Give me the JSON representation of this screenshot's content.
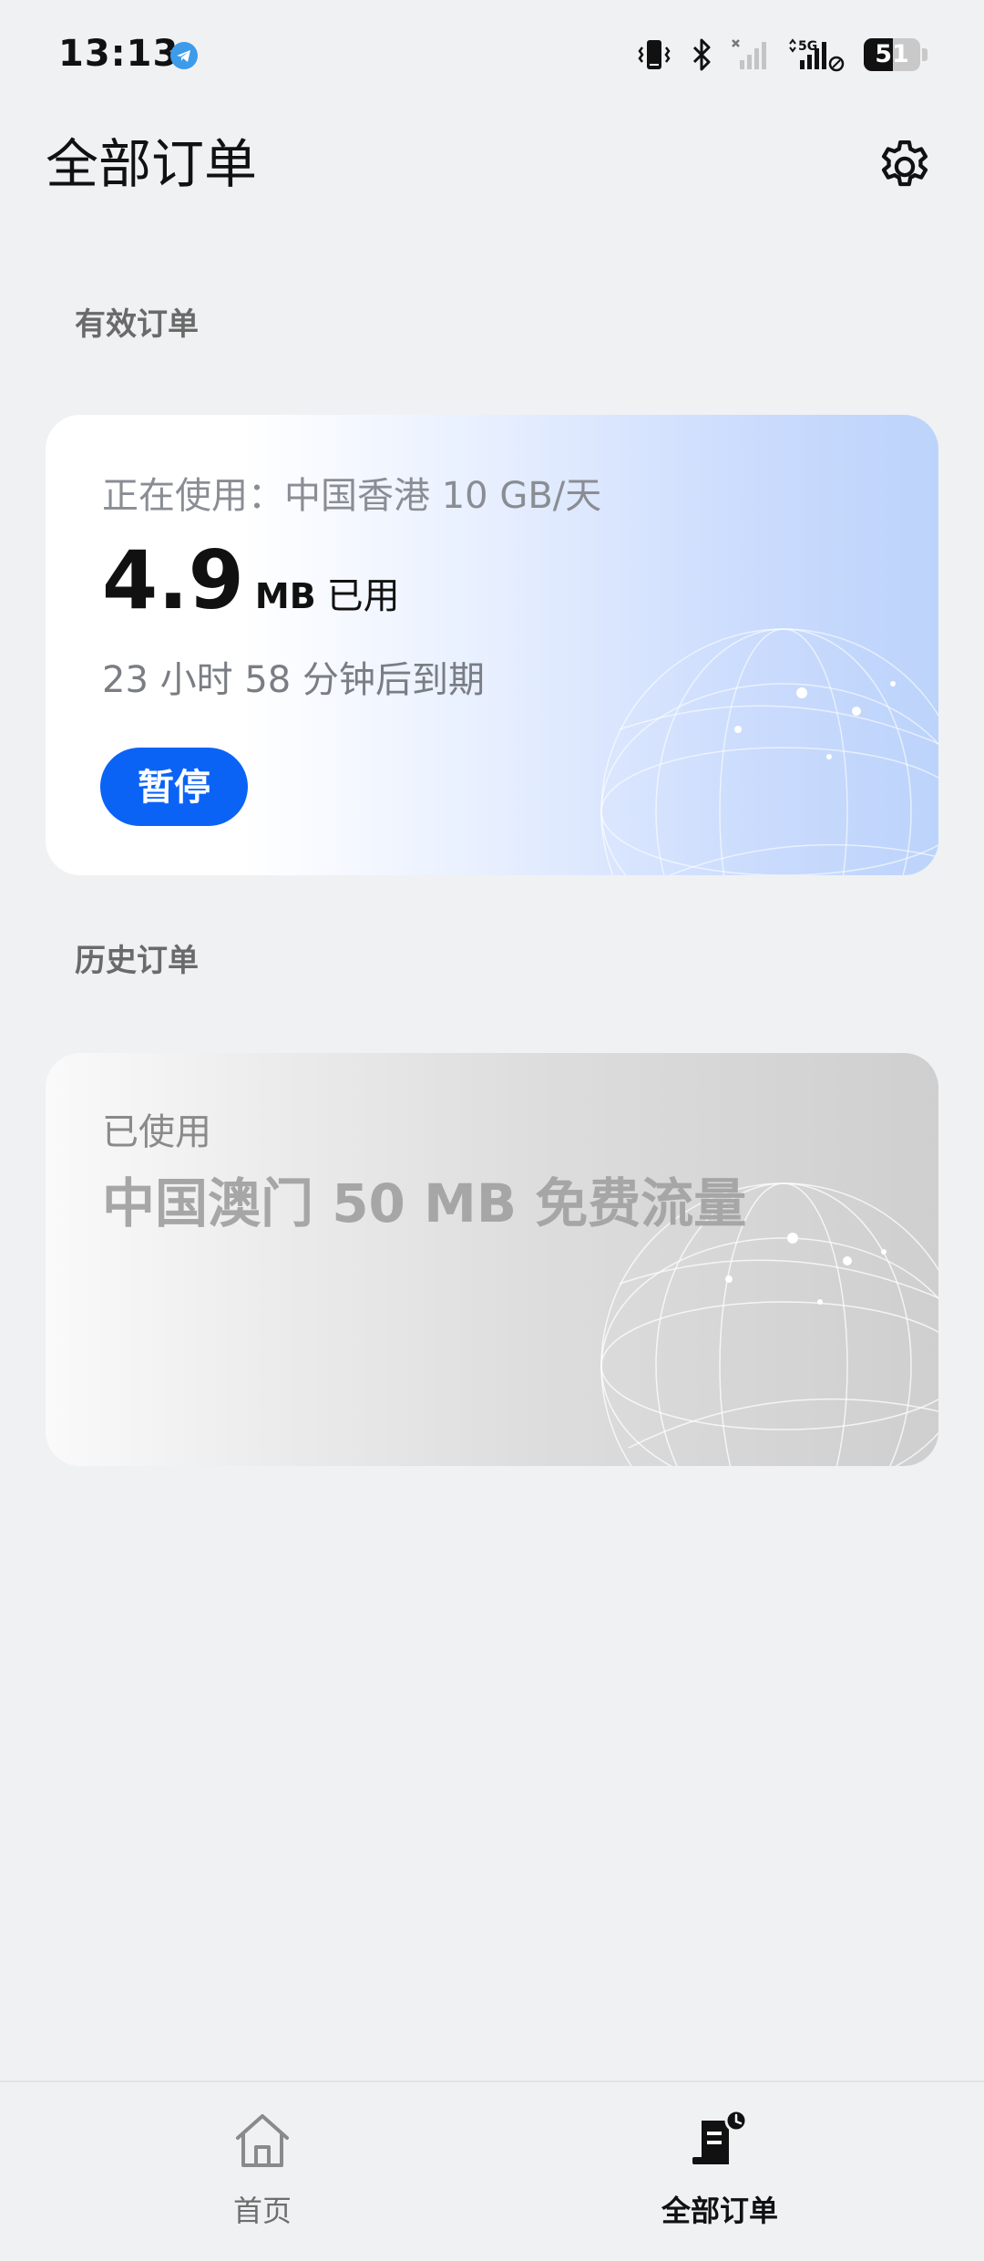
{
  "status_bar": {
    "time": "13:13",
    "battery_level": "51",
    "network_label": "5G",
    "icons": [
      "telegram-icon",
      "vibrate-icon",
      "bluetooth-icon",
      "signal-off-icon",
      "signal-5g-icon",
      "battery-icon"
    ]
  },
  "header": {
    "title": "全部订单",
    "settings_icon": "gear-icon"
  },
  "active_section": {
    "heading": "有效订单",
    "card": {
      "plan_label": "正在使用：中国香港 10 GB/天",
      "usage_value": "4.9",
      "usage_unit": "MB",
      "usage_suffix": "已用",
      "expire_text": "23 小时 58 分钟后到期",
      "pause_label": "暂停"
    }
  },
  "history_section": {
    "heading": "历史订单",
    "card": {
      "status": "已使用",
      "plan": "中国澳门 50 MB 免费流量"
    }
  },
  "bottom_nav": {
    "items": [
      {
        "label": "首页",
        "icon": "home-icon",
        "active": false
      },
      {
        "label": "全部订单",
        "icon": "orders-icon",
        "active": true
      }
    ]
  },
  "colors": {
    "accent": "#0b63f6",
    "background": "#f0f1f3"
  }
}
